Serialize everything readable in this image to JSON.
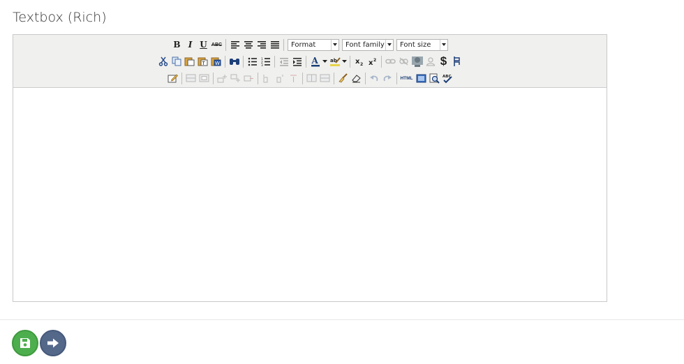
{
  "field": {
    "label": "Textbox (Rich)"
  },
  "toolbar": {
    "format_select": "Format",
    "font_family_select": "Font family",
    "font_size_select": "Font size",
    "bold": "B",
    "italic": "I",
    "underline": "U",
    "strike": "ABC",
    "html": "HTML",
    "dollar": "$"
  },
  "colors": {
    "toolbar_bg": "#f0f0ee",
    "save_button": "#4cae4c",
    "next_button": "#54688a"
  },
  "icons": [
    "bold-icon",
    "italic-icon",
    "underline-icon",
    "strikethrough-icon",
    "align-left-icon",
    "align-center-icon",
    "align-right-icon",
    "align-justify-icon",
    "cut-icon",
    "copy-icon",
    "paste-icon",
    "paste-text-icon",
    "paste-word-icon",
    "find-icon",
    "bullet-list-icon",
    "numbered-list-icon",
    "outdent-icon",
    "indent-icon",
    "font-color-icon",
    "highlight-icon",
    "subscript-icon",
    "superscript-icon",
    "link-icon",
    "unlink-icon",
    "image-icon",
    "user-icon",
    "dollar-icon",
    "anchor-icon",
    "edit-icon",
    "table-icon",
    "cleanup-icon",
    "eraser-icon",
    "undo-icon",
    "redo-icon",
    "html-icon",
    "fullscreen-icon",
    "preview-icon",
    "spellcheck-icon",
    "save-icon",
    "arrow-right-icon"
  ]
}
